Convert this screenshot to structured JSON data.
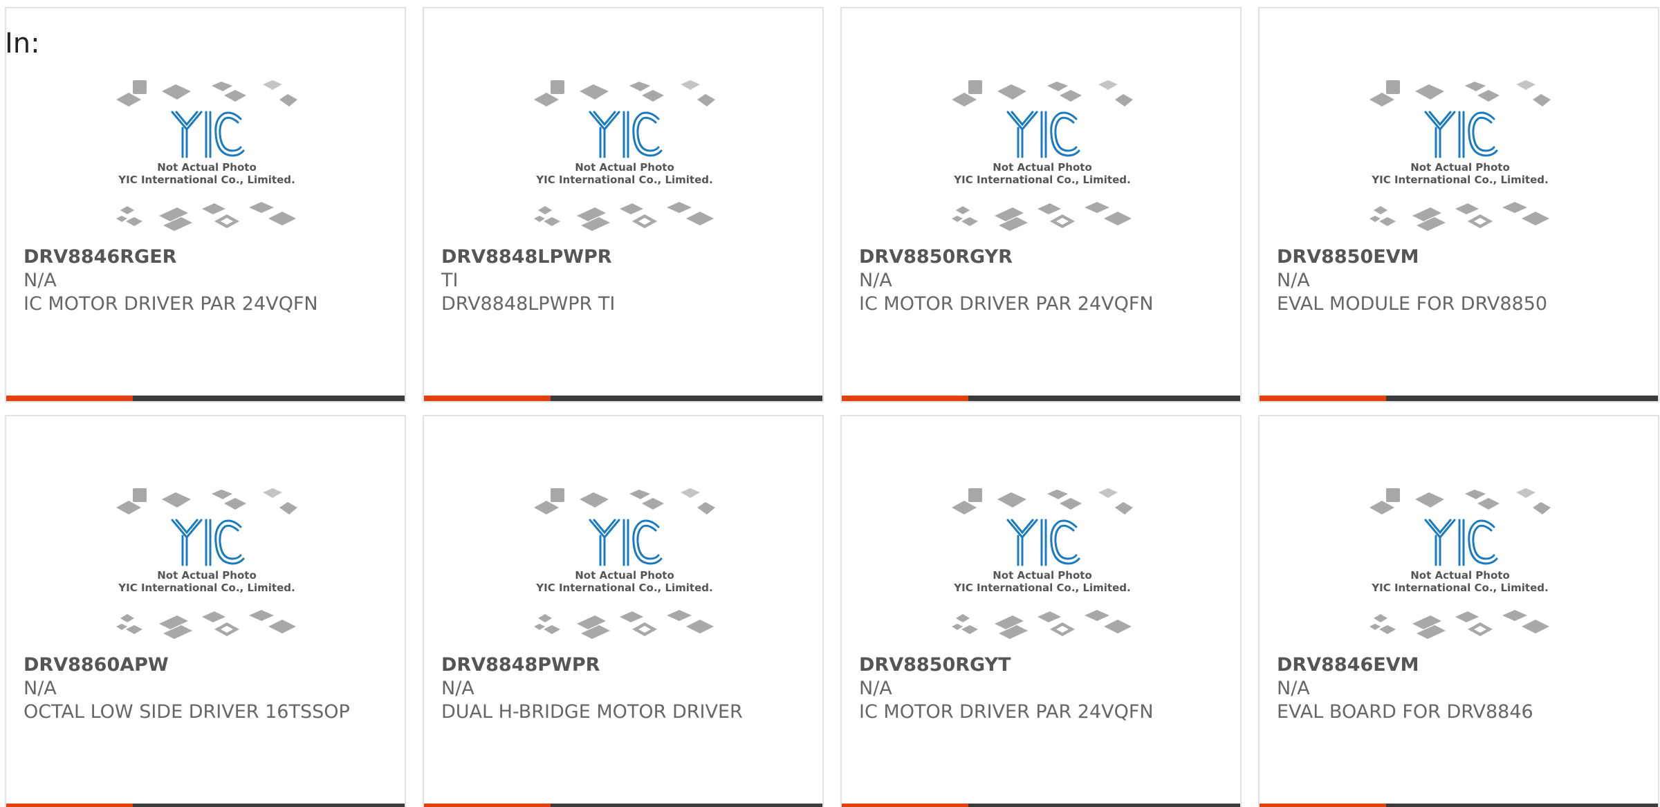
{
  "prefix_label": "In:",
  "colors": {
    "accent": "#e2400e",
    "bar": "#3b3b3b",
    "logo": "#1a7bc0"
  },
  "placeholder": {
    "logo_text": "YIC",
    "line1": "Not Actual Photo",
    "line2": "YIC International Co., Limited."
  },
  "products": [
    {
      "name": "DRV8846RGER",
      "brand": "N/A",
      "desc": "IC MOTOR DRIVER PAR 24VQFN"
    },
    {
      "name": "DRV8848LPWPR",
      "brand": "TI",
      "desc": "DRV8848LPWPR TI"
    },
    {
      "name": "DRV8850RGYR",
      "brand": "N/A",
      "desc": "IC MOTOR DRIVER PAR 24VQFN"
    },
    {
      "name": "DRV8850EVM",
      "brand": "N/A",
      "desc": "EVAL MODULE FOR DRV8850"
    },
    {
      "name": "DRV8860APW",
      "brand": "N/A",
      "desc": "OCTAL LOW SIDE DRIVER 16TSSOP"
    },
    {
      "name": "DRV8848PWPR",
      "brand": "N/A",
      "desc": "DUAL H-BRIDGE MOTOR DRIVER"
    },
    {
      "name": "DRV8850RGYT",
      "brand": "N/A",
      "desc": "IC MOTOR DRIVER PAR 24VQFN"
    },
    {
      "name": "DRV8846EVM",
      "brand": "N/A",
      "desc": "EVAL BOARD FOR DRV8846"
    }
  ]
}
